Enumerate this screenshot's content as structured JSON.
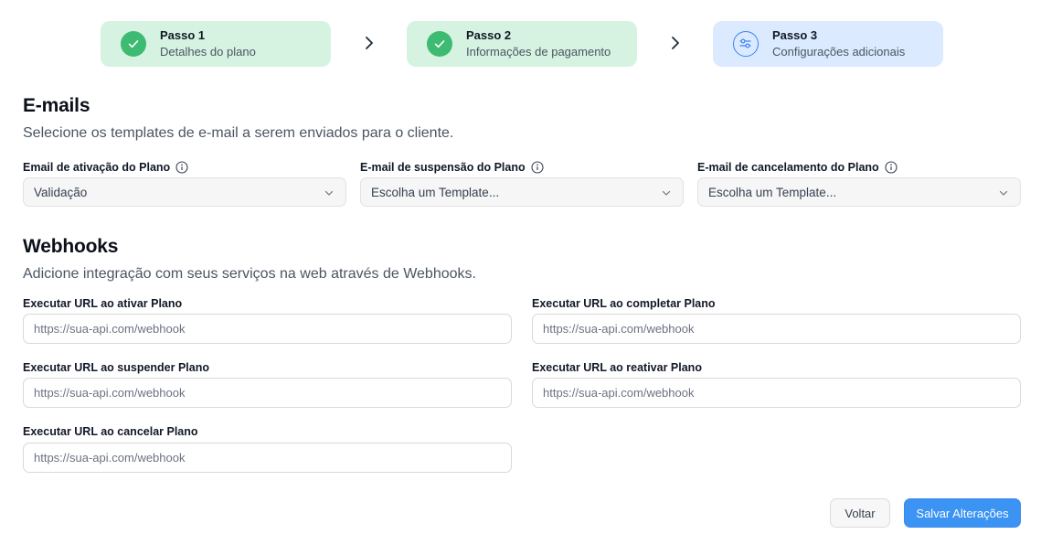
{
  "stepper": {
    "steps": [
      {
        "title": "Passo 1",
        "subtitle": "Detalhes do plano",
        "status": "done",
        "icon": "check-icon"
      },
      {
        "title": "Passo 2",
        "subtitle": "Informações de pagamento",
        "status": "done",
        "icon": "check-icon"
      },
      {
        "title": "Passo 3",
        "subtitle": "Configurações adicionais",
        "status": "active",
        "icon": "sliders-icon"
      }
    ],
    "colors": {
      "done_bg": "#d6f2e1",
      "done_circle": "#3dbb73",
      "active_bg": "#dbeafe",
      "active_accent": "#3b82f6"
    }
  },
  "emails": {
    "title": "E-mails",
    "description": "Selecione os templates de e-mail a serem enviados para o cliente.",
    "fields": [
      {
        "label": "Email de ativação do Plano",
        "value": "Validação"
      },
      {
        "label": "E-mail de suspensão do Plano",
        "value": "Escolha um Template..."
      },
      {
        "label": "E-mail de cancelamento do Plano",
        "value": "Escolha um Template..."
      }
    ]
  },
  "webhooks": {
    "title": "Webhooks",
    "description": "Adicione integração com seus serviços na web através de Webhooks.",
    "fields": [
      {
        "label": "Executar URL ao ativar Plano",
        "placeholder": "https://sua-api.com/webhook"
      },
      {
        "label": "Executar URL ao completar Plano",
        "placeholder": "https://sua-api.com/webhook"
      },
      {
        "label": "Executar URL ao suspender Plano",
        "placeholder": "https://sua-api.com/webhook"
      },
      {
        "label": "Executar URL ao reativar Plano",
        "placeholder": "https://sua-api.com/webhook"
      },
      {
        "label": "Executar URL ao cancelar Plano",
        "placeholder": "https://sua-api.com/webhook"
      }
    ]
  },
  "actions": {
    "back_label": "Voltar",
    "save_label": "Salvar Alterações",
    "primary_color": "#3b93f3"
  }
}
